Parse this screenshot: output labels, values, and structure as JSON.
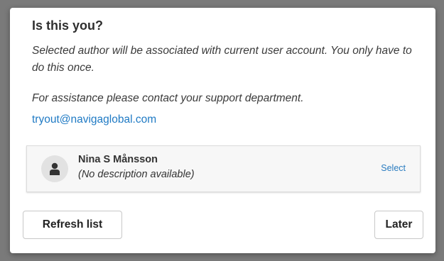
{
  "dialog": {
    "title": "Is this you?",
    "description": "Selected author will be associated with current user account. You only have to do this once.",
    "assistance_text": "For assistance please contact your support department.",
    "support_email": "tryout@navigaglobal.com",
    "authors": [
      {
        "name": "Nina S Månsson",
        "description": "(No description available)",
        "select_label": "Select",
        "avatar_icon": "person-icon"
      }
    ],
    "buttons": {
      "refresh_label": "Refresh list",
      "later_label": "Later"
    }
  },
  "colors": {
    "backdrop": "#7a7a7a",
    "link": "#1f7ac4",
    "card_background": "#f7f7f7"
  }
}
